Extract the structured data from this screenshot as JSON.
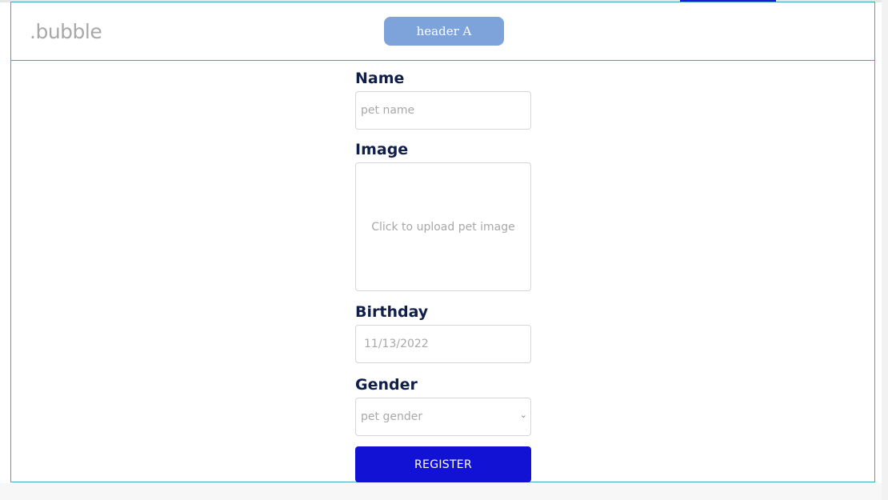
{
  "header": {
    "logo_text": ".bubble",
    "button_label": "header A"
  },
  "form": {
    "name": {
      "label": "Name",
      "placeholder": "pet name"
    },
    "image": {
      "label": "Image",
      "upload_text": "Click to upload pet image"
    },
    "birthday": {
      "label": "Birthday",
      "value": "11/13/2022"
    },
    "gender": {
      "label": "Gender",
      "placeholder": "pet gender"
    },
    "register_label": "REGISTER"
  },
  "colors": {
    "accent": "#1212d4",
    "header_button": "#7ea3db",
    "label": "#0f1f4a",
    "border": "#3fa7c4"
  }
}
